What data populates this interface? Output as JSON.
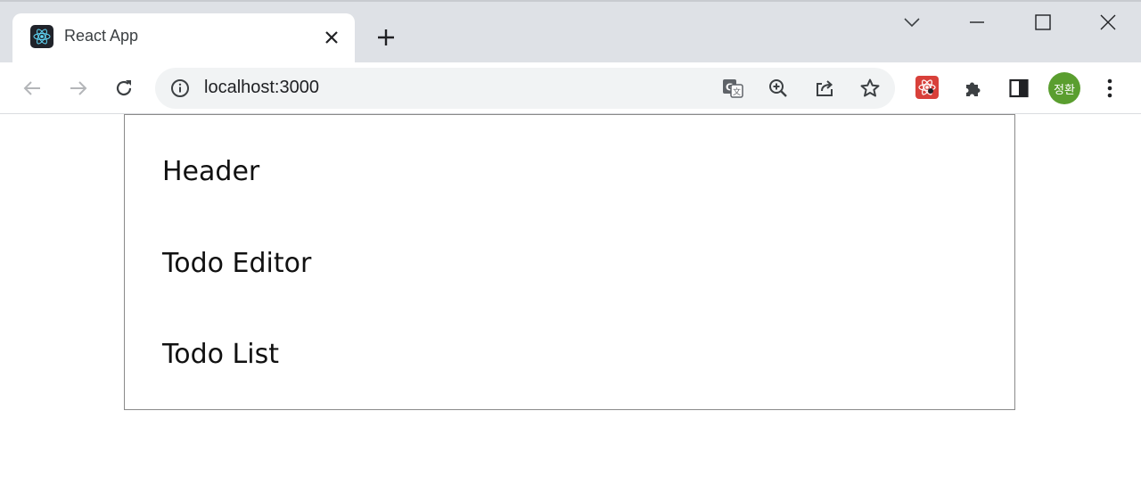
{
  "browser": {
    "tab": {
      "title": "React App"
    },
    "address_bar": {
      "url": "localhost:3000"
    },
    "profile": {
      "initials": "정환",
      "color": "#5a9e2f"
    },
    "icons": {
      "back": "arrow-left-icon",
      "forward": "arrow-right-icon",
      "reload": "reload-icon",
      "site_info": "info-icon",
      "translate": "translate-icon",
      "zoom": "zoom-in-icon",
      "share": "share-icon",
      "bookmark": "star-icon",
      "extension_react": "react-devtools-icon",
      "extensions": "puzzle-icon",
      "side_panel": "side-panel-icon",
      "menu": "kebab-menu-icon",
      "tab_search": "chevron-down-icon",
      "minimize": "minimize-icon",
      "maximize": "maximize-icon",
      "close": "close-icon"
    }
  },
  "app": {
    "sections": [
      {
        "label": "Header"
      },
      {
        "label": "Todo Editor"
      },
      {
        "label": "Todo List"
      }
    ]
  }
}
